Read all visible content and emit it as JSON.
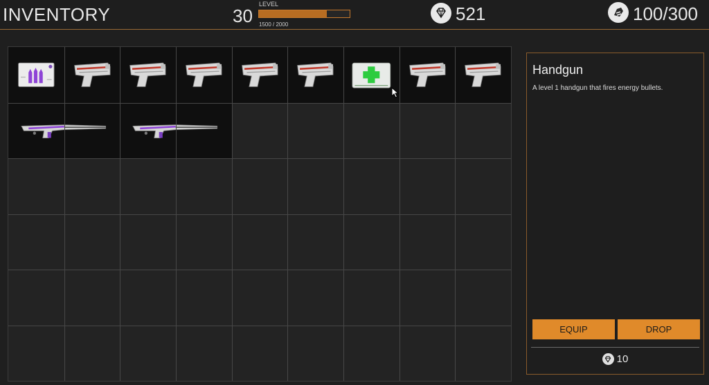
{
  "header": {
    "title": "INVENTORY",
    "level_number": "30",
    "level_label": "LEVEL",
    "xp_text": "1500 / 2000",
    "xp_fraction": 0.75,
    "gems": "521",
    "gems_icon": "diamond-icon",
    "weight": "100/300",
    "weight_icon": "weight-icon"
  },
  "inventory": {
    "columns": 9,
    "rows": 6,
    "items": [
      {
        "name": "ammo",
        "col": 0,
        "row": 0,
        "w": 1,
        "h": 1
      },
      {
        "name": "handgun",
        "col": 1,
        "row": 0,
        "w": 1,
        "h": 1
      },
      {
        "name": "handgun",
        "col": 2,
        "row": 0,
        "w": 1,
        "h": 1
      },
      {
        "name": "handgun",
        "col": 3,
        "row": 0,
        "w": 1,
        "h": 1
      },
      {
        "name": "handgun",
        "col": 4,
        "row": 0,
        "w": 1,
        "h": 1
      },
      {
        "name": "handgun",
        "col": 5,
        "row": 0,
        "w": 1,
        "h": 1
      },
      {
        "name": "medkit",
        "col": 6,
        "row": 0,
        "w": 1,
        "h": 1
      },
      {
        "name": "handgun",
        "col": 7,
        "row": 0,
        "w": 1,
        "h": 1
      },
      {
        "name": "handgun",
        "col": 8,
        "row": 0,
        "w": 1,
        "h": 1
      },
      {
        "name": "rifle",
        "col": 0,
        "row": 1,
        "w": 2,
        "h": 1
      },
      {
        "name": "rifle",
        "col": 2,
        "row": 1,
        "w": 2,
        "h": 1
      }
    ]
  },
  "details": {
    "item_name": "Handgun",
    "description": "A level 1 handgun that fires energy bullets.",
    "equip_label": "EQUIP",
    "drop_label": "DROP",
    "value": "10",
    "value_icon": "diamond-icon"
  },
  "colors": {
    "accent": "#e08a2a",
    "panel_border": "#8a5b2b",
    "background": "#1f1f1f"
  }
}
